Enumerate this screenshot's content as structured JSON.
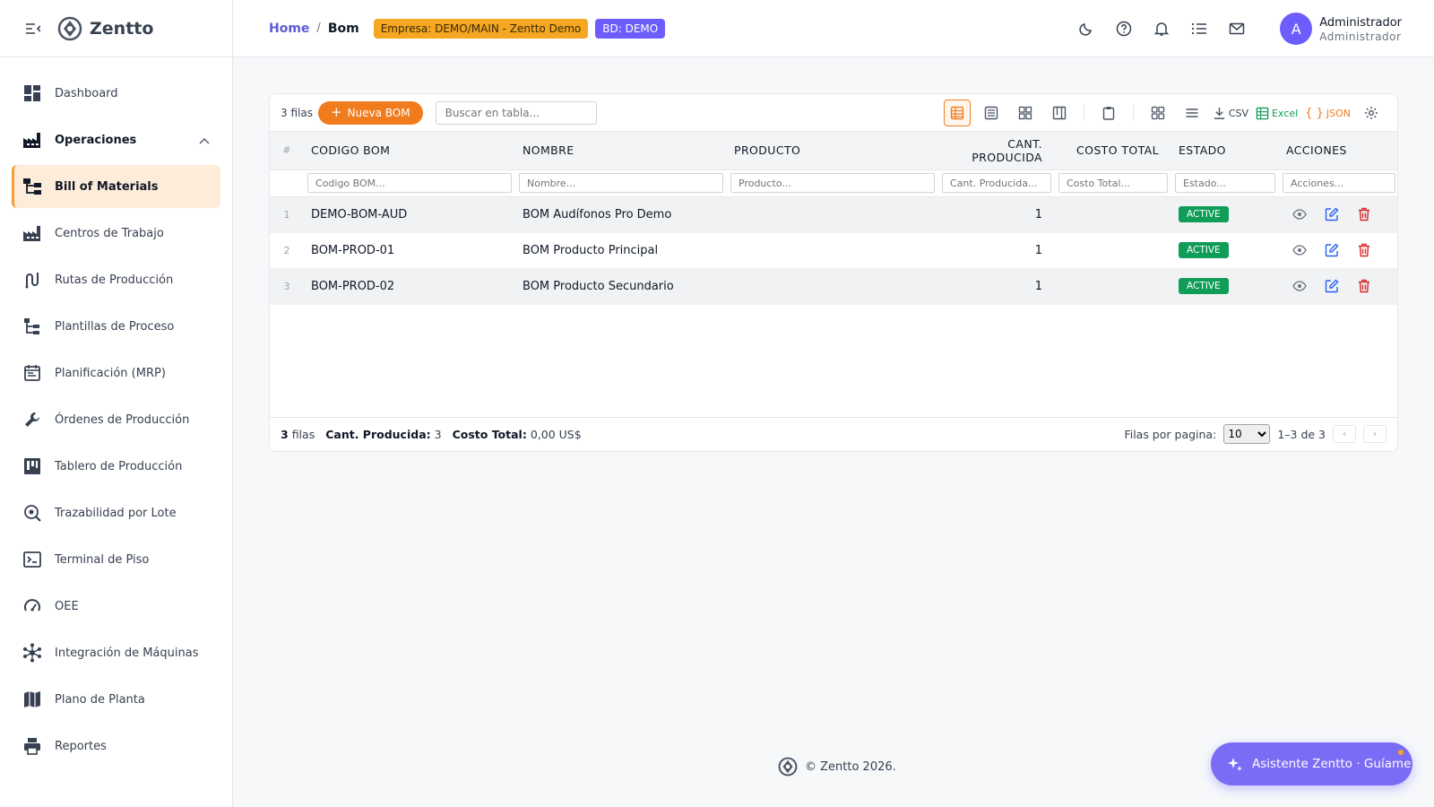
{
  "app": {
    "name": "Zentto"
  },
  "sidebar": {
    "items": [
      {
        "label": "Dashboard",
        "icon": "dashboard-icon"
      },
      {
        "label": "Operaciones",
        "icon": "factory-icon"
      },
      {
        "label": "Bill of Materials",
        "icon": "bom-tree-icon"
      },
      {
        "label": "Centros de Trabajo",
        "icon": "factory-icon"
      },
      {
        "label": "Rutas de Producción",
        "icon": "route-icon"
      },
      {
        "label": "Plantillas de Proceso",
        "icon": "template-icon"
      },
      {
        "label": "Planificación (MRP)",
        "icon": "calendar-icon"
      },
      {
        "label": "Órdenes de Producción",
        "icon": "wrench-icon"
      },
      {
        "label": "Tablero de Producción",
        "icon": "board-icon"
      },
      {
        "label": "Trazabilidad por Lote",
        "icon": "search-location-icon"
      },
      {
        "label": "Terminal de Piso",
        "icon": "terminal-icon"
      },
      {
        "label": "OEE",
        "icon": "gauge-icon"
      },
      {
        "label": "Integración de Máquinas",
        "icon": "hub-icon"
      },
      {
        "label": "Plano de Planta",
        "icon": "map-icon"
      },
      {
        "label": "Reportes",
        "icon": "printer-icon"
      }
    ]
  },
  "header": {
    "breadcrumb_home": "Home",
    "breadcrumb_sep": "/",
    "breadcrumb_current": "Bom",
    "empresa_badge": "Empresa: DEMO/MAIN - Zentto Demo",
    "bd_badge": "BD: DEMO",
    "user_initial": "A",
    "user_name": "Administrador",
    "user_role": "Administrador"
  },
  "toolbar": {
    "rows_label": "3 filas",
    "new_button": "Nueva BOM",
    "search_placeholder": "Buscar en tabla...",
    "csv_label": "CSV",
    "excel_label": "Excel",
    "json_label": "JSON"
  },
  "table": {
    "columns": [
      "#",
      "CODIGO BOM",
      "NOMBRE",
      "PRODUCTO",
      "CANT. PRODUCIDA",
      "COSTO TOTAL",
      "ESTADO",
      "ACCIONES"
    ],
    "filters": [
      "Codigo BOM...",
      "Nombre...",
      "Producto...",
      "Cant. Producida...",
      "Costo Total...",
      "Estado...",
      "Acciones..."
    ],
    "rows": [
      {
        "idx": "1",
        "codigo": "DEMO-BOM-AUD",
        "nombre": "BOM Audífonos Pro Demo",
        "producto": "",
        "cant": "1",
        "costo": "",
        "estado": "ACTIVE"
      },
      {
        "idx": "2",
        "codigo": "BOM-PROD-01",
        "nombre": "BOM Producto Principal",
        "producto": "",
        "cant": "1",
        "costo": "",
        "estado": "ACTIVE"
      },
      {
        "idx": "3",
        "codigo": "BOM-PROD-02",
        "nombre": "BOM Producto Secundario",
        "producto": "",
        "cant": "1",
        "costo": "",
        "estado": "ACTIVE"
      }
    ]
  },
  "table_footer": {
    "rows_count": "3",
    "rows_word": "filas",
    "cant_label": "Cant. Producida:",
    "cant_value": "3",
    "costo_label": "Costo Total:",
    "costo_value": "0,00 US$",
    "per_page_label": "Filas por pagina:",
    "per_page_value": "10",
    "range": "1–3 de 3"
  },
  "footer": {
    "copyright": "© Zentto 2026."
  },
  "assistant": {
    "label": "Asistente Zentto · Guíame"
  },
  "colors": {
    "accent": "#f07c1e",
    "brand": "#6d5dfc",
    "status_active": "#0f9d58",
    "danger": "#dc2626",
    "edit": "#2563eb"
  }
}
